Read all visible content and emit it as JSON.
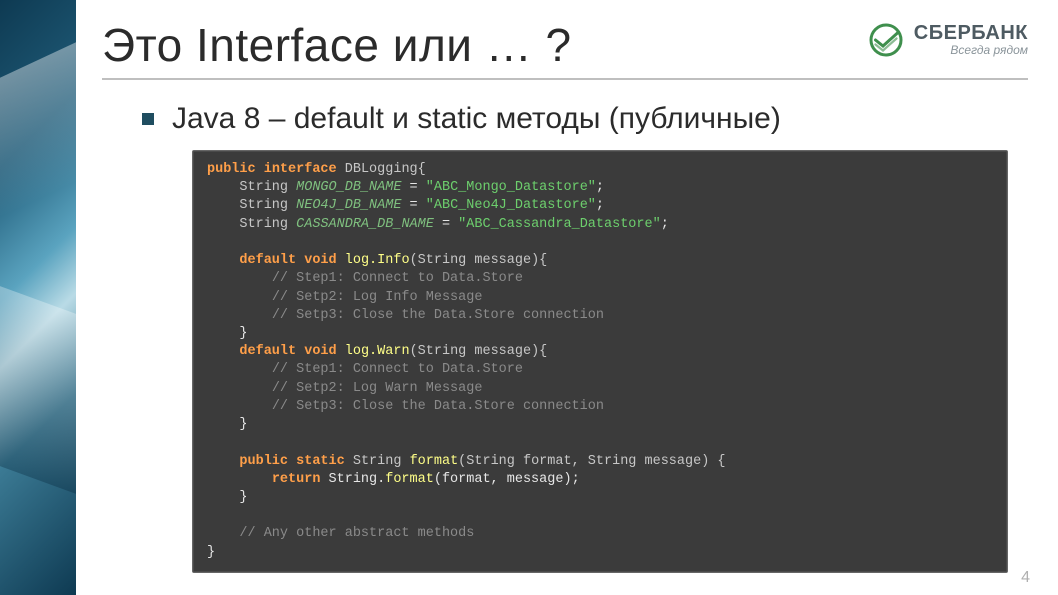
{
  "header": {
    "title": "Это Interface или … ?",
    "logo": {
      "brand": "СБЕРБАНК",
      "slogan": "Всегда рядом"
    }
  },
  "bullet": "Java 8 – default и static методы (публичные)",
  "code": {
    "l1": {
      "kw1": "public",
      "kw2": "interface",
      "name": "DBLogging{"
    },
    "l2": {
      "type": "String",
      "field": "MONGO_DB_NAME",
      "eq": " = ",
      "val": "\"ABC_Mongo_Datastore\"",
      "end": ";"
    },
    "l3": {
      "type": "String",
      "field": "NEO4J_DB_NAME",
      "eq": " = ",
      "val": "\"ABC_Neo4J_Datastore\"",
      "end": ";"
    },
    "l4": {
      "type": "String",
      "field": "CASSANDRA_DB_NAME",
      "eq": " = ",
      "val": "\"ABC_Cassandra_Datastore\"",
      "end": ";"
    },
    "l6": {
      "kw1": "default",
      "kw2": "void",
      "mth": "log.Info",
      "sig": "(String message){"
    },
    "l7": "// Step1: Connect to Data.Store",
    "l8": "// Setp2: Log Info Message",
    "l9": "// Setp3: Close the Data.Store connection",
    "l10": "}",
    "l11": {
      "kw1": "default",
      "kw2": "void",
      "mth": "log.Warn",
      "sig": "(String message){"
    },
    "l12": "// Step1: Connect to Data.Store",
    "l13": "// Setp2: Log Warn Message",
    "l14": "// Setp3: Close the Data.Store connection",
    "l15": "}",
    "l17": {
      "kw1": "public",
      "kw2": "static",
      "type": "String",
      "mth": "format",
      "sig": "(String format, String message) {"
    },
    "l18": {
      "kw": "return",
      "rest": " String.",
      "mth": "format",
      "tail": "(format, message);"
    },
    "l19": "}",
    "l21": "// Any other abstract methods",
    "l22": "}"
  },
  "page_number": "4"
}
